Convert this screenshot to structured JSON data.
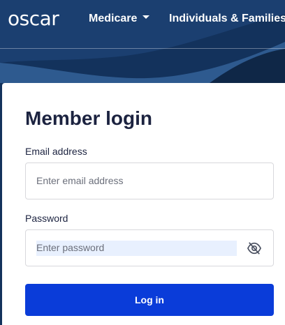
{
  "header": {
    "logo_text": "oscar",
    "nav": [
      {
        "label": "Medicare",
        "has_dropdown": true
      },
      {
        "label": "Individuals & Families",
        "has_dropdown": false
      }
    ]
  },
  "login": {
    "title": "Member login",
    "email_label": "Email address",
    "email_placeholder": "Enter email address",
    "password_label": "Password",
    "password_placeholder": "Enter password",
    "submit_label": "Log in",
    "password_toggle_icon": "eye-slash-icon"
  },
  "colors": {
    "header_bg": "#13325c",
    "primary_button": "#0a3cd9",
    "heading_text": "#1c2340"
  }
}
